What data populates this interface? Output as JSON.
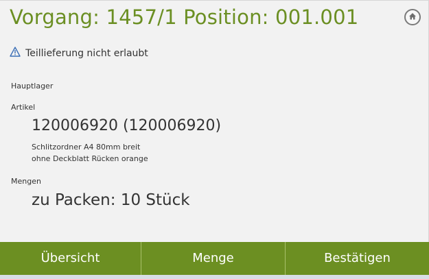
{
  "header": {
    "title": "Vorgang: 1457/1 Position: 001.001",
    "home_icon": "home-icon"
  },
  "warning": {
    "icon": "warning-triangle-icon",
    "text": "Teillieferung nicht erlaubt"
  },
  "warehouse": {
    "label": "Hauptlager"
  },
  "article": {
    "label": "Artikel",
    "number": "120006920 (120006920)",
    "description_line1": "Schlitzordner A4 80mm breit",
    "description_line2": "ohne Deckblatt Rücken orange"
  },
  "quantities": {
    "label": "Mengen",
    "to_pack": "zu Packen: 10 Stück"
  },
  "toolbar": {
    "overview_label": "Übersicht",
    "quantity_label": "Menge",
    "confirm_label": "Bestätigen"
  },
  "colors": {
    "accent": "#6c8f22",
    "title": "#6b8f23"
  }
}
